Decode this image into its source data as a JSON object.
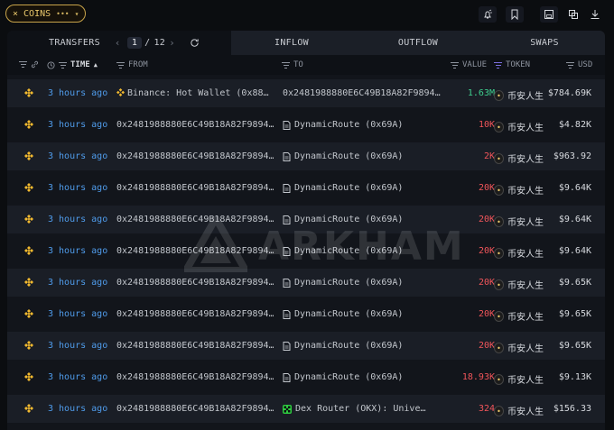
{
  "filter_chip": {
    "label": "COINS",
    "close_icon": "×",
    "menu_icon": "•••",
    "chevron": "▾"
  },
  "top_actions": [
    "alert-icon",
    "bookmark-icon",
    "save-icon",
    "copy-icon",
    "download-icon"
  ],
  "tabs": {
    "transfers": "TRANSFERS",
    "pager": {
      "prev": "‹",
      "current": "1",
      "separator": "/",
      "total": "12",
      "next": "›"
    },
    "inflow": "INFLOW",
    "outflow": "OUTFLOW",
    "swaps": "SWAPS"
  },
  "columns": {
    "time": "TIME",
    "from": "FROM",
    "to": "TO",
    "value": "VALUE",
    "token": "TOKEN",
    "usd": "USD"
  },
  "watermark": "ARKHAM",
  "rows": [
    {
      "time": "3 hours ago",
      "from": "Binance: Hot Wallet (0x88…",
      "to": "0x2481988880E6C49B18A82F9894…",
      "value": "1.63M",
      "value_color": "green",
      "token": "币安人生",
      "usd": "$784.69K"
    },
    {
      "time": "3 hours ago",
      "from": "0x2481988880E6C49B18A82F9894…",
      "to": "DynamicRoute (0x69A)",
      "value": "10K",
      "value_color": "red",
      "token": "币安人生",
      "usd": "$4.82K"
    },
    {
      "time": "3 hours ago",
      "from": "0x2481988880E6C49B18A82F9894…",
      "to": "DynamicRoute (0x69A)",
      "value": "2K",
      "value_color": "red",
      "token": "币安人生",
      "usd": "$963.92"
    },
    {
      "time": "3 hours ago",
      "from": "0x2481988880E6C49B18A82F9894…",
      "to": "DynamicRoute (0x69A)",
      "value": "20K",
      "value_color": "red",
      "token": "币安人生",
      "usd": "$9.64K"
    },
    {
      "time": "3 hours ago",
      "from": "0x2481988880E6C49B18A82F9894…",
      "to": "DynamicRoute (0x69A)",
      "value": "20K",
      "value_color": "red",
      "token": "币安人生",
      "usd": "$9.64K"
    },
    {
      "time": "3 hours ago",
      "from": "0x2481988880E6C49B18A82F9894…",
      "to": "DynamicRoute (0x69A)",
      "value": "20K",
      "value_color": "red",
      "token": "币安人生",
      "usd": "$9.64K"
    },
    {
      "time": "3 hours ago",
      "from": "0x2481988880E6C49B18A82F9894…",
      "to": "DynamicRoute (0x69A)",
      "value": "20K",
      "value_color": "red",
      "token": "币安人生",
      "usd": "$9.65K"
    },
    {
      "time": "3 hours ago",
      "from": "0x2481988880E6C49B18A82F9894…",
      "to": "DynamicRoute (0x69A)",
      "value": "20K",
      "value_color": "red",
      "token": "币安人生",
      "usd": "$9.65K"
    },
    {
      "time": "3 hours ago",
      "from": "0x2481988880E6C49B18A82F9894…",
      "to": "DynamicRoute (0x69A)",
      "value": "20K",
      "value_color": "red",
      "token": "币安人生",
      "usd": "$9.65K"
    },
    {
      "time": "3 hours ago",
      "from": "0x2481988880E6C49B18A82F9894…",
      "to": "DynamicRoute (0x69A)",
      "value": "18.93K",
      "value_color": "red",
      "token": "币安人生",
      "usd": "$9.13K"
    },
    {
      "time": "3 hours ago",
      "from": "0x2481988880E6C49B18A82F9894…",
      "to": "Dex Router (OKX): Unive…",
      "value": "324",
      "value_color": "red",
      "token": "币安人生",
      "usd": "$156.33"
    }
  ],
  "colors": {
    "accent_gold": "#e9c76a",
    "time_blue": "#4f9bea",
    "value_green": "#3ecf8e",
    "value_red": "#f1555a",
    "bnb_yellow": "#f3ba2f"
  }
}
